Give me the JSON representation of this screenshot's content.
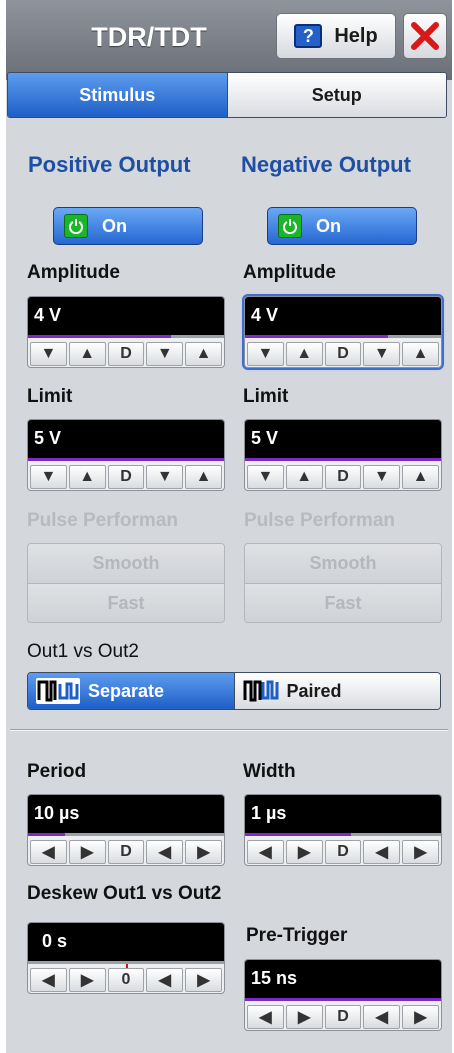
{
  "header": {
    "title": "TDR/TDT",
    "help_label": "Help"
  },
  "tabs": [
    {
      "label": "Stimulus",
      "active": true
    },
    {
      "label": "Setup",
      "active": false
    }
  ],
  "positive": {
    "heading": "Positive Output",
    "on_label": "On",
    "amplitude": {
      "label": "Amplitude",
      "value": "4 V",
      "level": 0.73
    },
    "limit": {
      "label": "Limit",
      "value": "5 V",
      "level": 1.0
    }
  },
  "negative": {
    "heading": "Negative Output",
    "on_label": "On",
    "amplitude": {
      "label": "Amplitude",
      "value": "4 V",
      "level": 0.73
    },
    "limit": {
      "label": "Limit",
      "value": "5 V",
      "level": 1.0
    }
  },
  "pulse_performance": {
    "label": "Pulse Performan",
    "options": [
      "Smooth",
      "Fast"
    ]
  },
  "out1_vs_out2": {
    "label": "Out1 vs Out2",
    "options": [
      {
        "label": "Separate",
        "active": true
      },
      {
        "label": "Paired",
        "active": false
      }
    ]
  },
  "period": {
    "label": "Period",
    "value": "10 µs",
    "level": 0.19
  },
  "width": {
    "label": "Width",
    "value": "1 µs",
    "level": 0.54
  },
  "deskew": {
    "label": "Deskew Out1 vs Out2",
    "value": "0 s",
    "center_label": "0"
  },
  "pre_trigger": {
    "label": "Pre-Trigger",
    "value": "15 ns",
    "level": 1.0
  },
  "buttons": {
    "down": "▼",
    "up": "▲",
    "default": "D",
    "left": "◀",
    "right": "▶"
  },
  "colors": {
    "accent_blue": "#1e5fc6",
    "heading_blue": "#1f4fa3",
    "level_purple": "#7a2bc8",
    "power_green": "#1bb52a",
    "close_red": "#d81919"
  }
}
